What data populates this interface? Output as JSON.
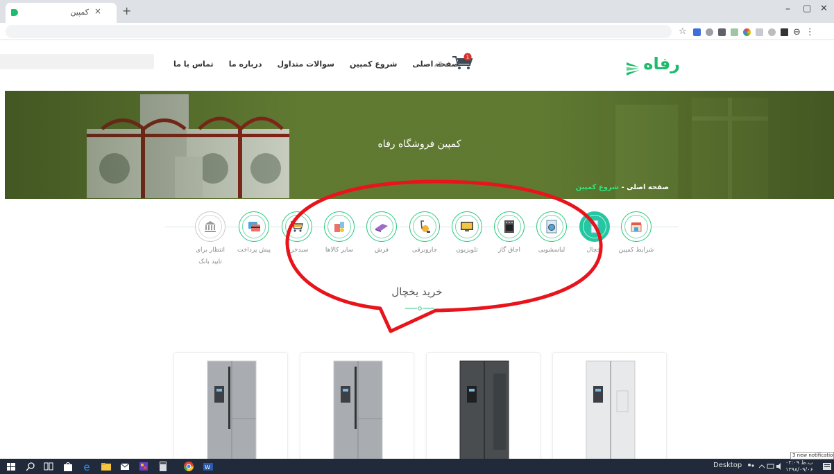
{
  "browser": {
    "tab_title": "کمپین",
    "tab_close": "×",
    "new_tab": "+",
    "window_controls": {
      "minimize": "–",
      "maximize": "▢",
      "close": "✕"
    },
    "toolbar": {
      "star": "☆",
      "profile": "⊖",
      "menu": "⋮"
    },
    "extensions": [
      "blue-ext-icon",
      "shield-ext-icon",
      "note-ext-icon",
      "grid-ext-icon",
      "color-ext-icon",
      "translate-ext-icon",
      "record-ext-icon",
      "ae-ext-icon"
    ]
  },
  "header": {
    "logo_text": "رفاه",
    "greeting": "سلام",
    "cart_count": "1",
    "nav": [
      "صفحه اصلی",
      "شروع کمپین",
      "سوالات متداول",
      "درباره ما",
      "تماس با ما"
    ]
  },
  "hero": {
    "title": "کمپین فروشگاه رفاه",
    "breadcrumb_home": "صفحه اصلی",
    "breadcrumb_sep": "-",
    "breadcrumb_current": "شروع کمپین"
  },
  "steps": [
    {
      "label": "شرایط کمپین",
      "icon": "shop-icon",
      "state": "done"
    },
    {
      "label": "یخچال",
      "icon": "fridge-icon",
      "state": "active"
    },
    {
      "label": "لباسشویی",
      "icon": "washer-icon",
      "state": "done"
    },
    {
      "label": "اجاق گاز",
      "icon": "stove-icon",
      "state": "done"
    },
    {
      "label": "تلویزیون",
      "icon": "tv-icon",
      "state": "done"
    },
    {
      "label": "جاروبرقی",
      "icon": "vacuum-icon",
      "state": "done"
    },
    {
      "label": "فرش",
      "icon": "carpet-icon",
      "state": "done"
    },
    {
      "label": "سایر کالاها",
      "icon": "appliances-icon",
      "state": "done"
    },
    {
      "label": "سبدخرید",
      "icon": "cart-icon",
      "state": "done"
    },
    {
      "label": "پیش پرداخت",
      "icon": "card-icon",
      "state": "done"
    },
    {
      "label": "انتظار برای تایید بانک",
      "icon": "bank-icon",
      "state": "pending"
    }
  ],
  "section": {
    "title": "خرید یخچال"
  },
  "products": [
    {
      "name": "fridge-silver-dispenser",
      "color": "#a9adb1"
    },
    {
      "name": "fridge-silver-dispenser-2",
      "color": "#a9adb1"
    },
    {
      "name": "fridge-black-glass",
      "color": "#4a4d50"
    },
    {
      "name": "fridge-white",
      "color": "#e8e9ea"
    }
  ],
  "taskbar": {
    "desktop_label": "Desktop",
    "clock_time": "ب.ظ ۰۲:۰۹",
    "clock_date": "۱۳۹۸/۰۹/۰۶",
    "notification_toast": "3 new notification"
  },
  "colors": {
    "brand": "#1dbb6b",
    "active_step": "#24c7a1",
    "annotation": "#e8131b"
  }
}
